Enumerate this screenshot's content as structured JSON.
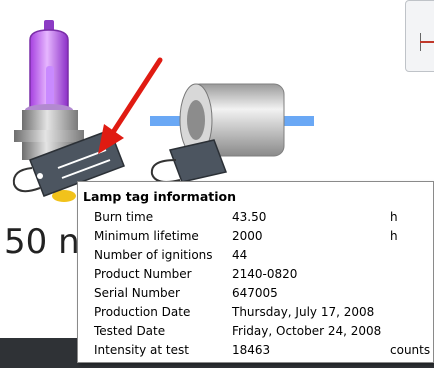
{
  "background_label": "50 n",
  "tooltip": {
    "title": "Lamp tag information",
    "rows": [
      {
        "label": "Burn time",
        "value": "43.50",
        "unit": "h"
      },
      {
        "label": "Minimum lifetime",
        "value": "2000",
        "unit": "h"
      },
      {
        "label": "Number of ignitions",
        "value": "44",
        "unit": ""
      },
      {
        "label": "Product Number",
        "value": "2140-0820",
        "unit": ""
      },
      {
        "label": "Serial Number",
        "value": "647005",
        "unit": ""
      },
      {
        "label": "Production Date",
        "value": "Thursday, July 17, 2008",
        "unit": ""
      },
      {
        "label": "Tested Date",
        "value": "Friday, October 24, 2008",
        "unit": ""
      },
      {
        "label": "Intensity at test",
        "value": "18463",
        "unit": "counts"
      }
    ]
  },
  "colors": {
    "lamp_glow": "#c45bf0",
    "arrow": "#e01b12",
    "beam": "#4aa3ff",
    "tag": "#4c5560"
  }
}
